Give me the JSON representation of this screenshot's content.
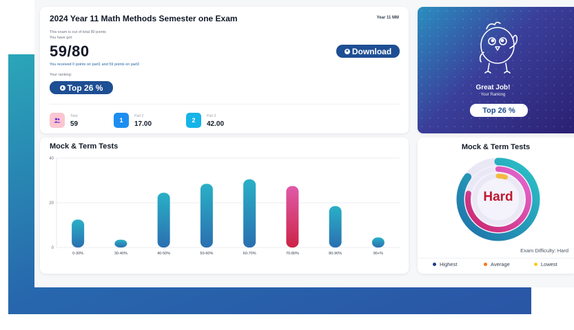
{
  "exam": {
    "title": "2024 Year 11 Math Methods Semester one Exam",
    "year_tag": "Year 11 MM",
    "out_of": "This exam is out of total 80 points",
    "you_have_got": "You have got:",
    "score": "59/80",
    "received": "You received 0 points on part1 and 59 points on part2",
    "ranking_label": "Your ranking:",
    "ranking_value": "Top 26 %",
    "download_label": "Download",
    "stats": [
      {
        "icon": "users-icon",
        "label": "Total",
        "value": "59",
        "color": "#fbc6d0"
      },
      {
        "icon": "1",
        "label": "Part 2",
        "value": "17.00",
        "color": "#1d8ef0"
      },
      {
        "icon": "2",
        "label": "Part 3",
        "value": "42.00",
        "color": "#16b4e8"
      }
    ]
  },
  "great_job": {
    "title": "Great Job!",
    "subtitle": "Your Ranking",
    "ranking": "Top 26 %"
  },
  "bar_card": {
    "title": "Mock & Term Tests"
  },
  "chart_data": [
    {
      "type": "bar",
      "title": "Mock & Term Tests",
      "categories": [
        "0-30%",
        "30-40%",
        "40-50%",
        "50-60%",
        "60-70%",
        "70-80%",
        "80-90%",
        "90+%"
      ],
      "values": [
        12.5,
        3.5,
        24.5,
        28.5,
        30.5,
        27.5,
        18.5,
        4.5
      ],
      "highlight_index": 5,
      "ylim": [
        0,
        40
      ],
      "yticks": [
        "0",
        "20",
        "40"
      ],
      "colors": {
        "default": "#2a8cc0",
        "highlight": "#d6336c"
      },
      "grid": true
    },
    {
      "type": "pie",
      "title": "Mock & Term Tests",
      "center_label": "Hard",
      "series": [
        {
          "name": "Highest",
          "value": 0.85,
          "color": "#1f86b4"
        },
        {
          "name": "Average",
          "value": 0.78,
          "color": "#d93d8a"
        },
        {
          "name": "Lowest",
          "value": 0.05,
          "color": "#f4b942"
        }
      ],
      "difficulty_label": "Exam Difficulty: Hard",
      "legend": [
        {
          "name": "Highest",
          "color": "#1e3a8a"
        },
        {
          "name": "Average",
          "color": "#f97316"
        },
        {
          "name": "Lowest",
          "color": "#facc15"
        }
      ]
    }
  ]
}
